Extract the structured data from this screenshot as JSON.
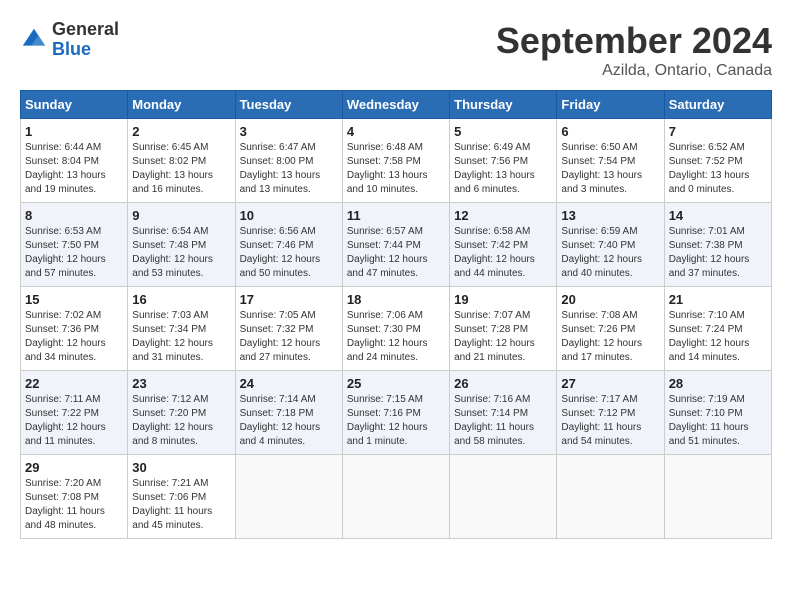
{
  "header": {
    "logo_general": "General",
    "logo_blue": "Blue",
    "month": "September 2024",
    "location": "Azilda, Ontario, Canada"
  },
  "weekdays": [
    "Sunday",
    "Monday",
    "Tuesday",
    "Wednesday",
    "Thursday",
    "Friday",
    "Saturday"
  ],
  "weeks": [
    [
      {
        "day": "1",
        "info": "Sunrise: 6:44 AM\nSunset: 8:04 PM\nDaylight: 13 hours\nand 19 minutes."
      },
      {
        "day": "2",
        "info": "Sunrise: 6:45 AM\nSunset: 8:02 PM\nDaylight: 13 hours\nand 16 minutes."
      },
      {
        "day": "3",
        "info": "Sunrise: 6:47 AM\nSunset: 8:00 PM\nDaylight: 13 hours\nand 13 minutes."
      },
      {
        "day": "4",
        "info": "Sunrise: 6:48 AM\nSunset: 7:58 PM\nDaylight: 13 hours\nand 10 minutes."
      },
      {
        "day": "5",
        "info": "Sunrise: 6:49 AM\nSunset: 7:56 PM\nDaylight: 13 hours\nand 6 minutes."
      },
      {
        "day": "6",
        "info": "Sunrise: 6:50 AM\nSunset: 7:54 PM\nDaylight: 13 hours\nand 3 minutes."
      },
      {
        "day": "7",
        "info": "Sunrise: 6:52 AM\nSunset: 7:52 PM\nDaylight: 13 hours\nand 0 minutes."
      }
    ],
    [
      {
        "day": "8",
        "info": "Sunrise: 6:53 AM\nSunset: 7:50 PM\nDaylight: 12 hours\nand 57 minutes."
      },
      {
        "day": "9",
        "info": "Sunrise: 6:54 AM\nSunset: 7:48 PM\nDaylight: 12 hours\nand 53 minutes."
      },
      {
        "day": "10",
        "info": "Sunrise: 6:56 AM\nSunset: 7:46 PM\nDaylight: 12 hours\nand 50 minutes."
      },
      {
        "day": "11",
        "info": "Sunrise: 6:57 AM\nSunset: 7:44 PM\nDaylight: 12 hours\nand 47 minutes."
      },
      {
        "day": "12",
        "info": "Sunrise: 6:58 AM\nSunset: 7:42 PM\nDaylight: 12 hours\nand 44 minutes."
      },
      {
        "day": "13",
        "info": "Sunrise: 6:59 AM\nSunset: 7:40 PM\nDaylight: 12 hours\nand 40 minutes."
      },
      {
        "day": "14",
        "info": "Sunrise: 7:01 AM\nSunset: 7:38 PM\nDaylight: 12 hours\nand 37 minutes."
      }
    ],
    [
      {
        "day": "15",
        "info": "Sunrise: 7:02 AM\nSunset: 7:36 PM\nDaylight: 12 hours\nand 34 minutes."
      },
      {
        "day": "16",
        "info": "Sunrise: 7:03 AM\nSunset: 7:34 PM\nDaylight: 12 hours\nand 31 minutes."
      },
      {
        "day": "17",
        "info": "Sunrise: 7:05 AM\nSunset: 7:32 PM\nDaylight: 12 hours\nand 27 minutes."
      },
      {
        "day": "18",
        "info": "Sunrise: 7:06 AM\nSunset: 7:30 PM\nDaylight: 12 hours\nand 24 minutes."
      },
      {
        "day": "19",
        "info": "Sunrise: 7:07 AM\nSunset: 7:28 PM\nDaylight: 12 hours\nand 21 minutes."
      },
      {
        "day": "20",
        "info": "Sunrise: 7:08 AM\nSunset: 7:26 PM\nDaylight: 12 hours\nand 17 minutes."
      },
      {
        "day": "21",
        "info": "Sunrise: 7:10 AM\nSunset: 7:24 PM\nDaylight: 12 hours\nand 14 minutes."
      }
    ],
    [
      {
        "day": "22",
        "info": "Sunrise: 7:11 AM\nSunset: 7:22 PM\nDaylight: 12 hours\nand 11 minutes."
      },
      {
        "day": "23",
        "info": "Sunrise: 7:12 AM\nSunset: 7:20 PM\nDaylight: 12 hours\nand 8 minutes."
      },
      {
        "day": "24",
        "info": "Sunrise: 7:14 AM\nSunset: 7:18 PM\nDaylight: 12 hours\nand 4 minutes."
      },
      {
        "day": "25",
        "info": "Sunrise: 7:15 AM\nSunset: 7:16 PM\nDaylight: 12 hours\nand 1 minute."
      },
      {
        "day": "26",
        "info": "Sunrise: 7:16 AM\nSunset: 7:14 PM\nDaylight: 11 hours\nand 58 minutes."
      },
      {
        "day": "27",
        "info": "Sunrise: 7:17 AM\nSunset: 7:12 PM\nDaylight: 11 hours\nand 54 minutes."
      },
      {
        "day": "28",
        "info": "Sunrise: 7:19 AM\nSunset: 7:10 PM\nDaylight: 11 hours\nand 51 minutes."
      }
    ],
    [
      {
        "day": "29",
        "info": "Sunrise: 7:20 AM\nSunset: 7:08 PM\nDaylight: 11 hours\nand 48 minutes."
      },
      {
        "day": "30",
        "info": "Sunrise: 7:21 AM\nSunset: 7:06 PM\nDaylight: 11 hours\nand 45 minutes."
      },
      {
        "day": "",
        "info": ""
      },
      {
        "day": "",
        "info": ""
      },
      {
        "day": "",
        "info": ""
      },
      {
        "day": "",
        "info": ""
      },
      {
        "day": "",
        "info": ""
      }
    ]
  ]
}
